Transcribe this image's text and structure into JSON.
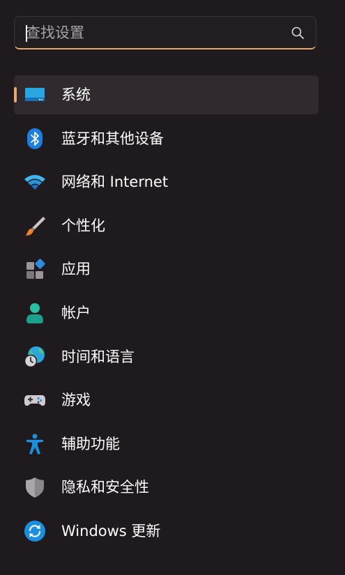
{
  "search": {
    "placeholder": "查找设置",
    "accent_color": "#e8a86e"
  },
  "sidebar": {
    "selected_index": 0,
    "items": [
      {
        "label": "系统",
        "icon": "monitor-icon"
      },
      {
        "label": "蓝牙和其他设备",
        "icon": "bluetooth-icon"
      },
      {
        "label": "网络和 Internet",
        "icon": "wifi-icon"
      },
      {
        "label": "个性化",
        "icon": "paintbrush-icon"
      },
      {
        "label": "应用",
        "icon": "apps-icon"
      },
      {
        "label": "帐户",
        "icon": "account-icon"
      },
      {
        "label": "时间和语言",
        "icon": "globe-clock-icon"
      },
      {
        "label": "游戏",
        "icon": "gamepad-icon"
      },
      {
        "label": "辅助功能",
        "icon": "accessibility-icon"
      },
      {
        "label": "隐私和安全性",
        "icon": "shield-icon"
      },
      {
        "label": "Windows 更新",
        "icon": "refresh-icon"
      }
    ]
  }
}
